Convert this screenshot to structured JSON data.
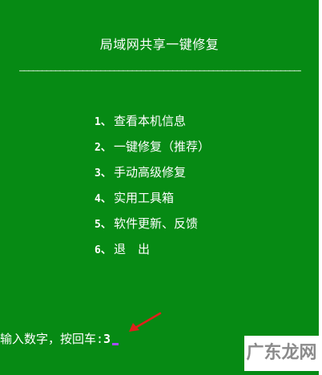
{
  "title": "局域网共享一键修复",
  "divider": "———————————————————————————————————————————————————————————————————————————",
  "menu": {
    "items": [
      {
        "num": "1、",
        "label": "查看本机信息"
      },
      {
        "num": "2、",
        "label": "一键修复（推荐）"
      },
      {
        "num": "3、",
        "label": "手动高级修复"
      },
      {
        "num": "4、",
        "label": "实用工具箱"
      },
      {
        "num": "5、",
        "label": "软件更新、反馈"
      },
      {
        "num": "6、",
        "label": "退　出"
      }
    ]
  },
  "prompt": {
    "label": "输入数字，按回车:",
    "value": "3"
  },
  "watermark": "广东龙网",
  "colors": {
    "background": "#068a14",
    "text": "#ffffff",
    "cursor": "#a64cff",
    "arrow": "#e0201b",
    "watermark": "#8b8b8b"
  }
}
